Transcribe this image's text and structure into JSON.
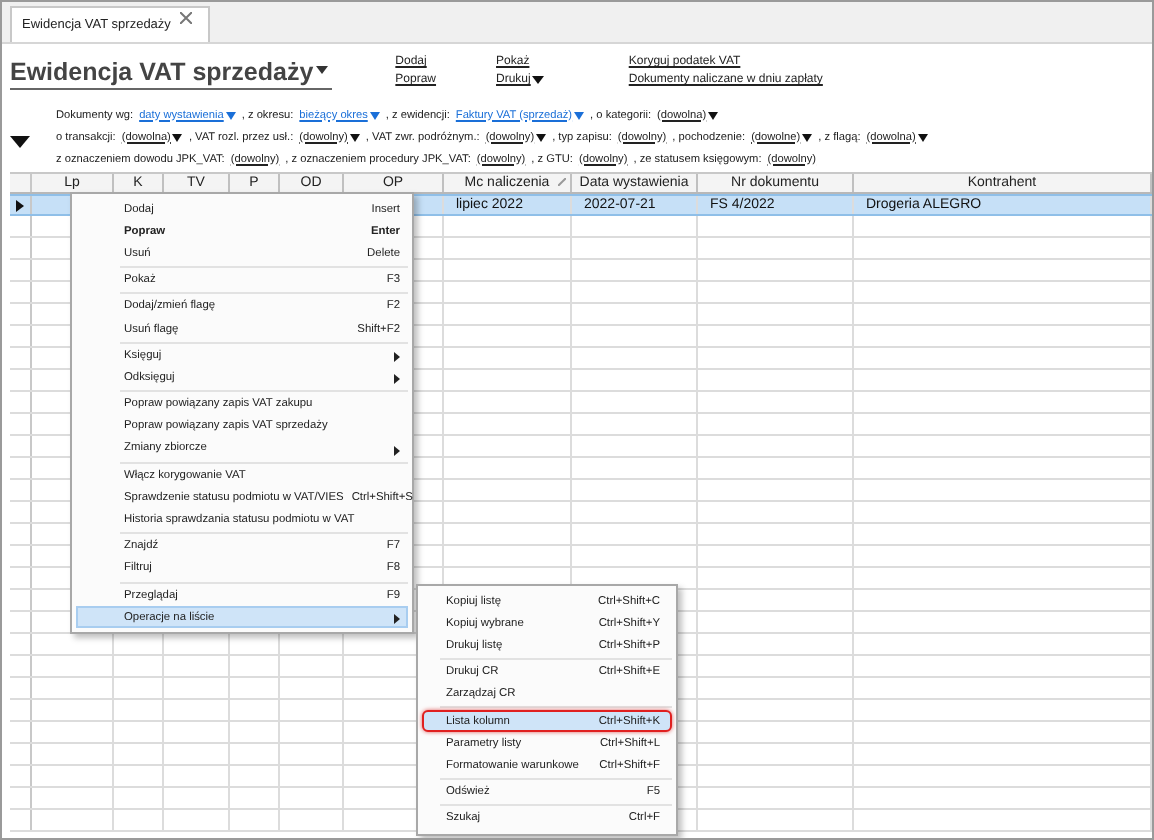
{
  "tab": {
    "label": "Ewidencja VAT sprzedaży",
    "selected": true
  },
  "title": {
    "text": "Ewidencja VAT sprzedaży",
    "dropdown": true
  },
  "actions": [
    [
      {
        "label": "Dodaj",
        "dropdown": false
      },
      {
        "label": "Popraw",
        "dropdown": false
      }
    ],
    [
      {
        "label": "Pokaż",
        "dropdown": false
      },
      {
        "label": "Drukuj",
        "dropdown": true
      }
    ],
    [
      {
        "label": "Koryguj podatek VAT",
        "dropdown": false
      },
      {
        "label": "Dokumenty naliczane w dniu zapłaty",
        "dropdown": false
      }
    ]
  ],
  "filters": [
    [
      {
        "label": "Dokumenty wg:",
        "value": "daty wystawienia",
        "dropdown": true,
        "highlighted": true
      },
      {
        "label": ", z okresu:",
        "value": "bieżący okres",
        "dropdown": true,
        "highlighted": true
      },
      {
        "label": ", z ewidencji:",
        "value": "Faktury VAT (sprzedaż)",
        "dropdown": true,
        "highlighted": true
      },
      {
        "label": ", o kategorii:",
        "value": "(dowolna)",
        "dropdown": true,
        "highlighted": false
      }
    ],
    [
      {
        "label": "o transakcji:",
        "value": "(dowolna)",
        "dropdown": true,
        "highlighted": false
      },
      {
        "label": ", VAT rozl. przez usł.:",
        "value": "(dowolny)",
        "dropdown": true,
        "highlighted": false
      },
      {
        "label": ", VAT zwr. podróżnym.:",
        "value": "(dowolny)",
        "dropdown": true,
        "highlighted": false
      },
      {
        "label": ", typ zapisu:",
        "value": "(dowolny)",
        "dropdown": false,
        "highlighted": false
      },
      {
        "label": ", pochodzenie:",
        "value": "(dowolne)",
        "dropdown": true,
        "highlighted": false
      },
      {
        "label": ", z flagą:",
        "value": "(dowolna)",
        "dropdown": true,
        "highlighted": false
      }
    ],
    [
      {
        "label": "z oznaczeniem dowodu JPK_VAT:",
        "value": "(dowolny)",
        "dropdown": false,
        "highlighted": false
      },
      {
        "label": ", z oznaczeniem procedury JPK_VAT:",
        "value": "(dowolny)",
        "dropdown": false,
        "highlighted": false
      },
      {
        "label": ", z GTU:",
        "value": "(dowolny)",
        "dropdown": false,
        "highlighted": false
      },
      {
        "label": ", ze statusem księgowym:",
        "value": "(dowolny)",
        "dropdown": false,
        "highlighted": false
      }
    ]
  ],
  "table": {
    "columns": [
      {
        "label": "Lp",
        "sorted": false
      },
      {
        "label": "K",
        "sorted": false
      },
      {
        "label": "TV",
        "sorted": false
      },
      {
        "label": "P",
        "sorted": false
      },
      {
        "label": "OD",
        "sorted": false
      },
      {
        "label": "OP",
        "sorted": false
      },
      {
        "label": "Mc naliczenia",
        "sorted": true
      },
      {
        "label": "Data wystawienia",
        "sorted": false
      },
      {
        "label": "Nr dokumentu",
        "sorted": false
      },
      {
        "label": "Kontrahent",
        "sorted": false
      }
    ],
    "rows": [
      {
        "selected": true,
        "cells": [
          "",
          "",
          "",
          "",
          "",
          "",
          "lipiec 2022",
          "2022-07-21",
          "FS 4/2022",
          "Drogeria ALEGRO"
        ]
      }
    ]
  },
  "context_menu": [
    {
      "kind": "item",
      "label": "Dodaj",
      "shortcut": "Insert",
      "bold": false,
      "submenu": false,
      "selected": false
    },
    {
      "kind": "item",
      "label": "Popraw",
      "shortcut": "Enter",
      "bold": true,
      "submenu": false,
      "selected": false
    },
    {
      "kind": "item",
      "label": "Usuń",
      "shortcut": "Delete",
      "bold": false,
      "submenu": false,
      "selected": false
    },
    {
      "kind": "separator"
    },
    {
      "kind": "item",
      "label": "Pokaż",
      "shortcut": "F3",
      "bold": false,
      "submenu": false,
      "selected": false
    },
    {
      "kind": "separator"
    },
    {
      "kind": "item",
      "label": "Dodaj/zmień flagę",
      "shortcut": "F2",
      "bold": false,
      "submenu": false,
      "selected": false
    },
    {
      "kind": "item",
      "label": "Usuń flagę",
      "shortcut": "Shift+F2",
      "bold": false,
      "submenu": false,
      "selected": false
    },
    {
      "kind": "separator"
    },
    {
      "kind": "item",
      "label": "Księguj",
      "bold": false,
      "submenu": true,
      "selected": false
    },
    {
      "kind": "item",
      "label": "Odksięguj",
      "bold": false,
      "submenu": true,
      "selected": false
    },
    {
      "kind": "separator"
    },
    {
      "kind": "item",
      "label": "Popraw powiązany zapis VAT zakupu",
      "bold": false,
      "submenu": false,
      "selected": false
    },
    {
      "kind": "item",
      "label": "Popraw powiązany zapis VAT sprzedaży",
      "bold": false,
      "submenu": false,
      "selected": false
    },
    {
      "kind": "item",
      "label": "Zmiany zbiorcze",
      "bold": false,
      "submenu": true,
      "selected": false
    },
    {
      "kind": "separator"
    },
    {
      "kind": "item",
      "label": "Włącz korygowanie VAT",
      "bold": false,
      "submenu": false,
      "selected": false
    },
    {
      "kind": "item",
      "label": "Sprawdzenie statusu podmiotu w VAT/VIES",
      "shortcut": "Ctrl+Shift+S",
      "bold": false,
      "submenu": false,
      "selected": false
    },
    {
      "kind": "item",
      "label": "Historia sprawdzania statusu podmiotu w VAT",
      "bold": false,
      "submenu": false,
      "selected": false
    },
    {
      "kind": "separator"
    },
    {
      "kind": "item",
      "label": "Znajdź",
      "shortcut": "F7",
      "bold": false,
      "submenu": false,
      "selected": false
    },
    {
      "kind": "item",
      "label": "Filtruj",
      "shortcut": "F8",
      "bold": false,
      "submenu": false,
      "selected": false
    },
    {
      "kind": "separator"
    },
    {
      "kind": "item",
      "label": "Przeglądaj",
      "shortcut": "F9",
      "bold": false,
      "submenu": false,
      "selected": false
    },
    {
      "kind": "item",
      "label": "Operacje na liście",
      "bold": false,
      "submenu": true,
      "selected": true
    }
  ],
  "submenu": [
    {
      "kind": "item",
      "label": "Kopiuj listę",
      "shortcut": "Ctrl+Shift+C",
      "selected": false
    },
    {
      "kind": "item",
      "label": "Kopiuj wybrane",
      "shortcut": "Ctrl+Shift+Y",
      "selected": false
    },
    {
      "kind": "item",
      "label": "Drukuj listę",
      "shortcut": "Ctrl+Shift+P",
      "selected": false
    },
    {
      "kind": "separator"
    },
    {
      "kind": "item",
      "label": "Drukuj CR",
      "shortcut": "Ctrl+Shift+E",
      "selected": false
    },
    {
      "kind": "item",
      "label": "Zarządzaj CR",
      "selected": false
    },
    {
      "kind": "separator"
    },
    {
      "kind": "item",
      "label": "Lista kolumn",
      "shortcut": "Ctrl+Shift+K",
      "selected": true
    },
    {
      "kind": "item",
      "label": "Parametry listy",
      "shortcut": "Ctrl+Shift+L",
      "selected": false
    },
    {
      "kind": "item",
      "label": "Formatowanie warunkowe",
      "shortcut": "Ctrl+Shift+F",
      "selected": false
    },
    {
      "kind": "separator"
    },
    {
      "kind": "item",
      "label": "Odśwież",
      "shortcut": "F5",
      "selected": false
    },
    {
      "kind": "separator"
    },
    {
      "kind": "item",
      "label": "Szukaj",
      "shortcut": "Ctrl+F",
      "selected": false
    }
  ]
}
